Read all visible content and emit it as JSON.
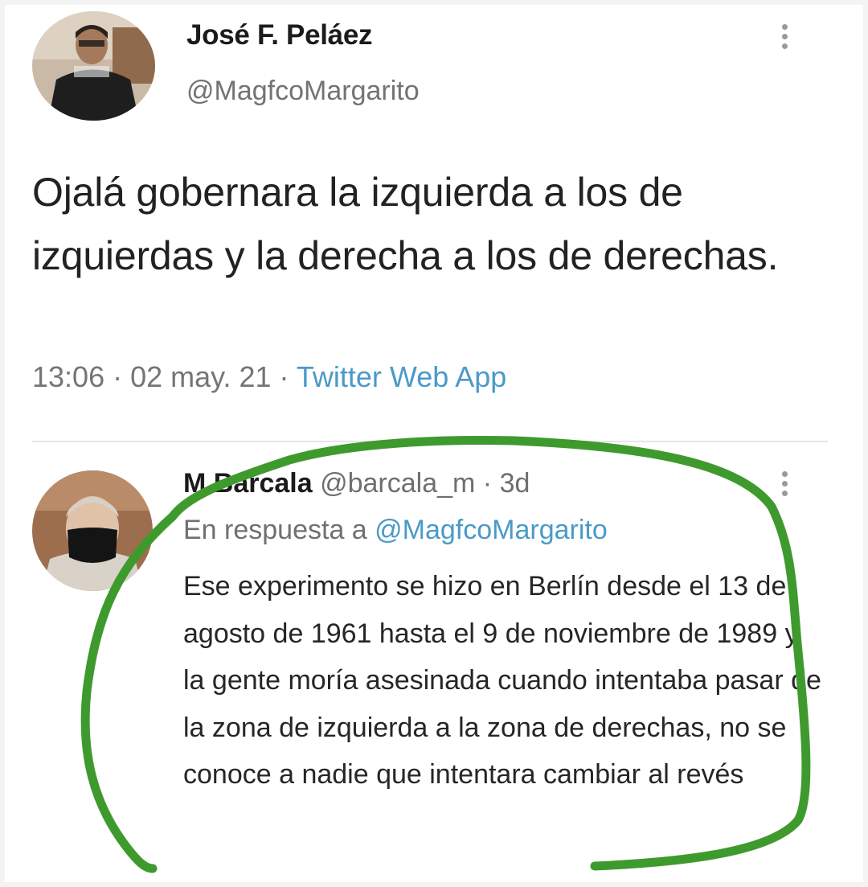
{
  "tweet": {
    "author_name": "José F. Peláez",
    "author_handle": "@MagfcoMargarito",
    "text": "Ojalá gobernara la izquierda a los de izquierdas y la derecha a los de derechas.",
    "time": "13:06",
    "date": "02 may. 21",
    "separator": " · ",
    "source": "Twitter Web App"
  },
  "reply": {
    "author_name": "M Barcala",
    "author_handle": "@barcala_m",
    "age": "3d",
    "in_reply_prefix": "En respuesta a",
    "in_reply_handle": "@MagfcoMargarito",
    "text": "Ese experimento se hizo en Berlín desde el 13 de agosto de 1961 hasta el 9 de noviembre de 1989 y la gente moría asesinada cuando intentaba pasar de la zona de izquierda a la zona de derechas, no se conoce a nadie que intentara cambiar al revés"
  },
  "icons": {
    "more": "more-vertical-icon"
  },
  "colors": {
    "link": "#4a9ac9",
    "highlight_marker": "#3f9a2e",
    "muted_text": "#737373"
  }
}
